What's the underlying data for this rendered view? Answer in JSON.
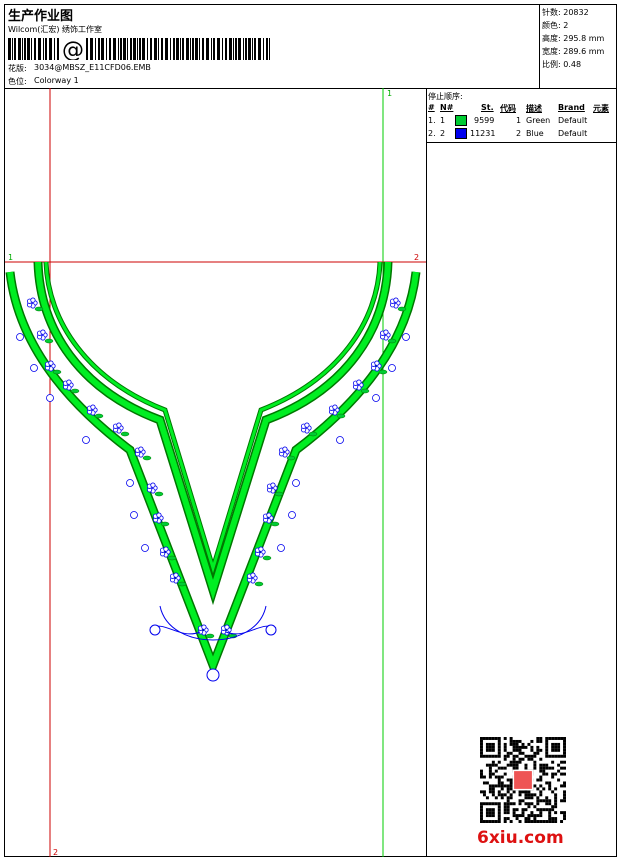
{
  "header": {
    "title": "生产作业图",
    "company": "Wilcom(汇宏) 绣饰工作室",
    "barcode_text": "@",
    "design_label": "花版:",
    "design_file": "3034@MBSZ_E11CFD06.EMB",
    "color_label": "色位:",
    "colorway": "Colorway 1"
  },
  "stats": {
    "stitches_label": "针数:",
    "stitches": "20832",
    "colors_label": "颜色:",
    "colors": "2",
    "height_label": "高度:",
    "height": "295.8 mm",
    "width_label": "宽度:",
    "width": "289.6 mm",
    "scale_label": "比例:",
    "scale": "0.48"
  },
  "sequence": {
    "title": "停止顺序:",
    "headers": [
      "#",
      "N#",
      "St.",
      "代码",
      "描述",
      "Brand",
      "元素"
    ],
    "rows": [
      {
        "idx": "1.",
        "n": "1",
        "st": "9599",
        "code": "1",
        "desc": "Green",
        "brand": "Default",
        "color": "#00cc33"
      },
      {
        "idx": "2.",
        "n": "2",
        "st": "11231",
        "code": "2",
        "desc": "Blue",
        "brand": "Default",
        "color": "#0000ee"
      }
    ]
  },
  "guides": {
    "top_left": "1",
    "top_right": "2",
    "right_top": "1",
    "bottom_left": "2"
  },
  "watermark": "6xiu.com",
  "colors": {
    "green": "#00cc33",
    "blue": "#0000ee",
    "guide_red": "#cc0000",
    "guide_green": "#00cc00"
  }
}
